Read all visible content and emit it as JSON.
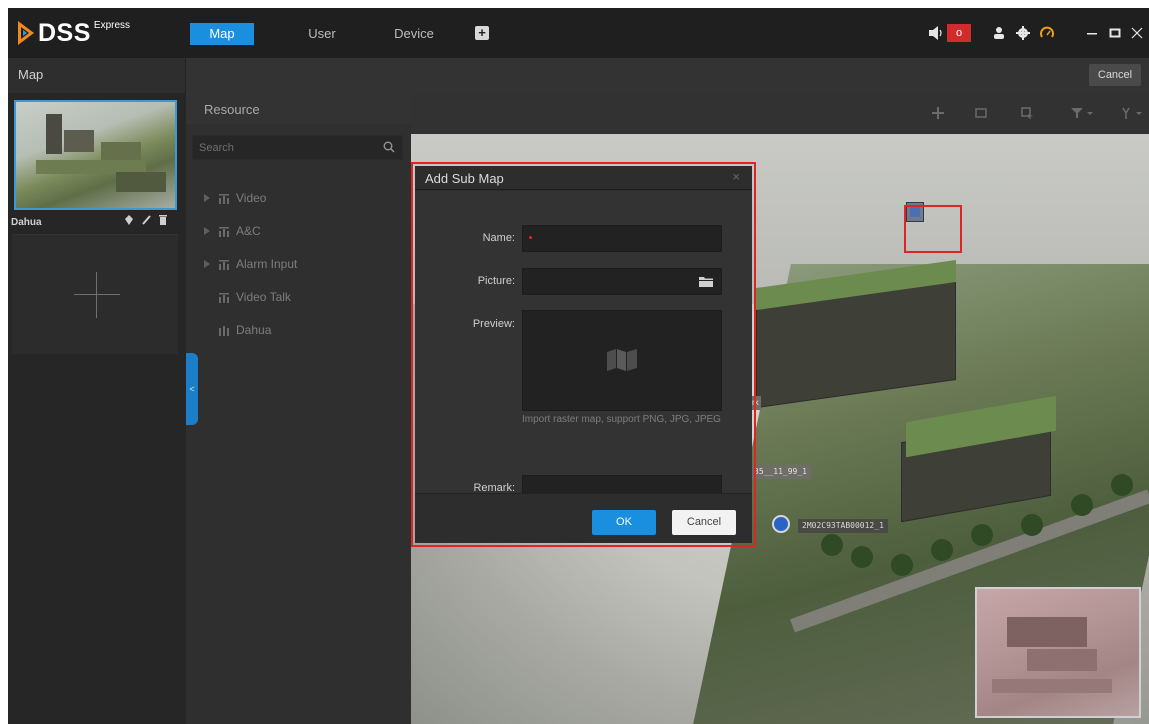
{
  "app": {
    "logo_text": "DSS",
    "logo_sup": "Express",
    "nav_tabs": [
      {
        "label": "Map",
        "active": true
      },
      {
        "label": "User",
        "active": false
      },
      {
        "label": "Device",
        "active": false
      }
    ],
    "add_tab_symbol": "+",
    "alarm_count": "o",
    "accent_color": "#1a8fe0",
    "alarm_color": "#d22b2b",
    "icons": [
      "volume-icon",
      "user-icon",
      "gear-icon",
      "speedometer-icon",
      "minimize-icon",
      "maximize-icon",
      "close-icon"
    ]
  },
  "subbar": {
    "title": "Map",
    "cancel_label": "Cancel"
  },
  "map_list": {
    "selected_map_name": "Dahua"
  },
  "resource": {
    "title": "Resource",
    "search_placeholder": "Search",
    "tree": [
      {
        "label": "Video",
        "expandable": true
      },
      {
        "label": "A&C",
        "expandable": true
      },
      {
        "label": "Alarm Input",
        "expandable": true
      },
      {
        "label": "Video Talk",
        "expandable": false
      },
      {
        "label": "Dahua",
        "expandable": false
      }
    ],
    "collapse_symbol": "<"
  },
  "map": {
    "device_labels": {
      "pin_label": "2M02C93TAB00012_1",
      "device_label": "35__11_99_1",
      "partial_label": "rk"
    }
  },
  "dialog": {
    "title": "Add Sub Map",
    "close_symbol": "×",
    "name_label": "Name:",
    "name_value": "",
    "picture_label": "Picture:",
    "picture_value": "",
    "preview_label": "Preview:",
    "preview_hint": "Import raster map, support PNG, JPG, JPEG",
    "remark_label": "Remark:",
    "remark_value": "",
    "ok_label": "OK",
    "cancel_label": "Cancel"
  }
}
